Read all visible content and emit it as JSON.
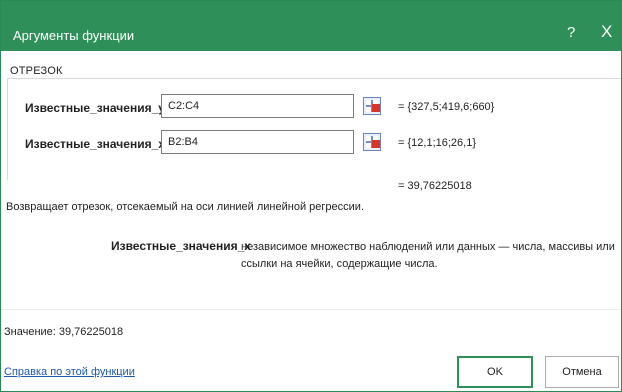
{
  "dialog": {
    "title": "Аргументы функции",
    "help_label": "?",
    "close_label": "X",
    "function_name": "ОТРЕЗОК"
  },
  "arguments": [
    {
      "label": "Известные_значения_y",
      "input_value": "C2:C4",
      "preview": "=   {327,5;419,6;660}"
    },
    {
      "label": "Известные_значения_x",
      "input_value": "B2:B4",
      "preview": "=   {12,1;16;26,1}"
    }
  ],
  "result_preview": "=   39,76225018",
  "description": "Возвращает отрезок, отсекаемый на оси линией линейной регрессии.",
  "argument_help": {
    "label": "Известные_значения_x",
    "text": "независимое множество наблюдений или данных — числа, массивы или ссылки на ячейки, содержащие числа."
  },
  "value_line": "Значение:   39,76225018",
  "help_link": "Справка по этой функции",
  "buttons": {
    "ok": "OK",
    "cancel": "Отмена"
  },
  "colors": {
    "titlebar": "#2f8f58",
    "link": "#1f5aa8"
  }
}
